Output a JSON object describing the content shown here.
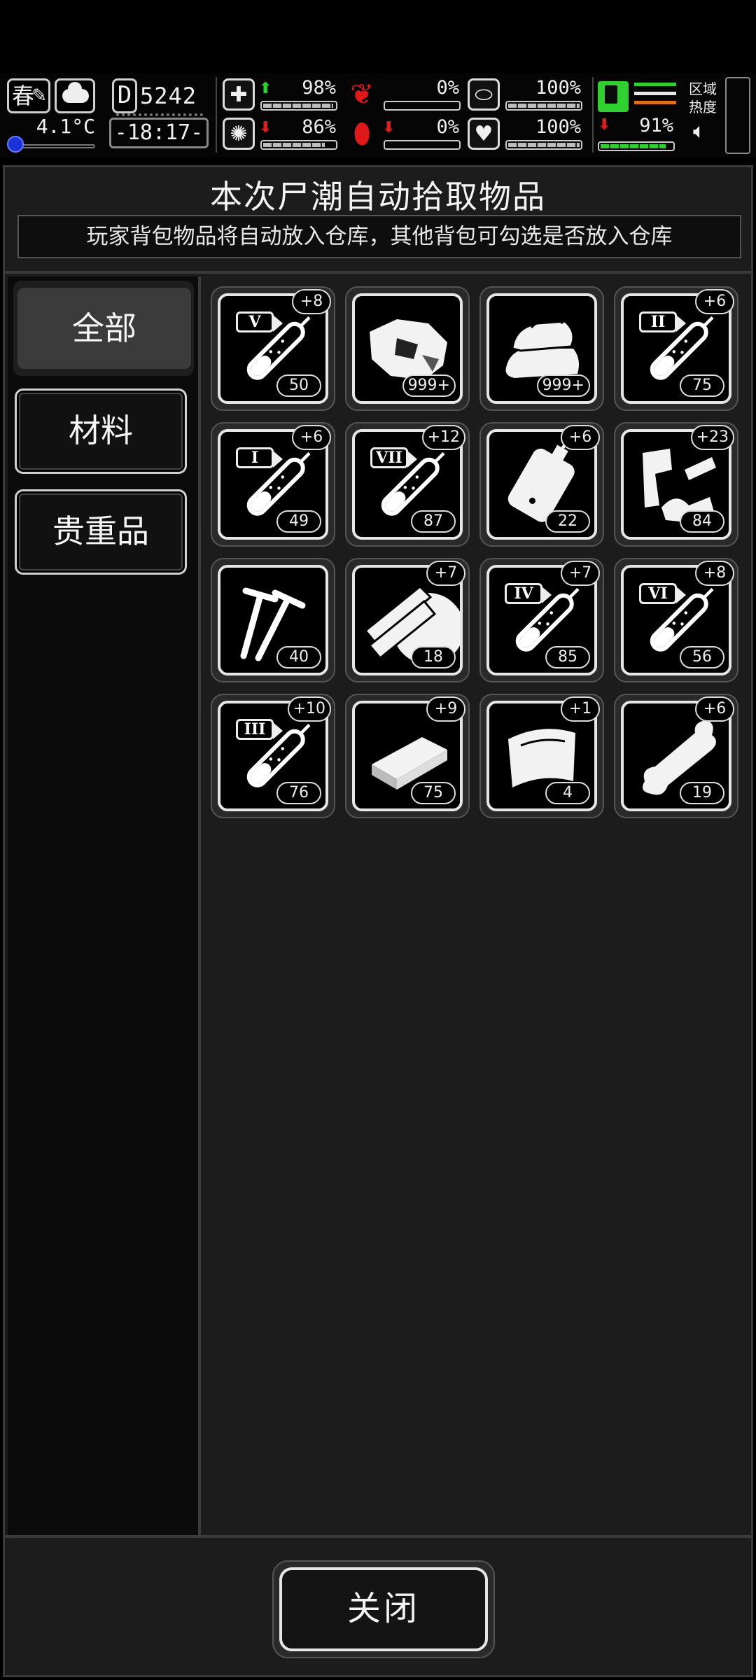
{
  "hud": {
    "season": "春",
    "temperature": "4.1°C",
    "day_label": "D",
    "day_number": "5242",
    "clock": "-18:17-",
    "stats": [
      {
        "icon": "medkit-icon",
        "glyph": "✚",
        "trend": "up",
        "value": "98%",
        "level": 0.98
      },
      {
        "icon": "stomach-icon",
        "glyph": "❦",
        "trend": "none",
        "value": "0%",
        "level": 0.0
      },
      {
        "icon": "pill-icon",
        "glyph": "⬭",
        "trend": "none",
        "value": "100%",
        "level": 1.0
      },
      {
        "icon": "brain-icon",
        "glyph": "✺",
        "trend": "down",
        "value": "86%",
        "level": 0.86
      },
      {
        "icon": "blood-drop-icon",
        "glyph": "⬮",
        "trend": "down",
        "value": "0%",
        "level": 0.0
      },
      {
        "icon": "heart-icon",
        "glyph": "♥",
        "trend": "none",
        "value": "100%",
        "level": 1.0
      }
    ],
    "stamina": {
      "trend": "down",
      "value": "91%",
      "level": 0.91
    },
    "zone_label_1": "区域",
    "zone_label_2": "热度",
    "colors": {
      "green": "#2fd02f",
      "red": "#e01818",
      "orange": "#e07018",
      "blue": "#1a32d8"
    }
  },
  "dialog": {
    "title": "本次尸潮自动拾取物品",
    "notice": "玩家背包物品将自动放入仓库，其他背包可勾选是否放入仓库",
    "tabs": [
      {
        "label": "全部",
        "active": true
      },
      {
        "label": "材料",
        "active": false
      },
      {
        "label": "贵重品",
        "active": false
      }
    ],
    "items": [
      {
        "icon": "syringe-icon",
        "roman": "V",
        "badge": "+8",
        "count": "50"
      },
      {
        "icon": "meat-chunk-icon",
        "roman": "",
        "badge": "",
        "count": "999+"
      },
      {
        "icon": "cloth-pile-icon",
        "roman": "",
        "badge": "",
        "count": "999+"
      },
      {
        "icon": "syringe-icon",
        "roman": "II",
        "badge": "+6",
        "count": "75"
      },
      {
        "icon": "syringe-icon",
        "roman": "I",
        "badge": "+6",
        "count": "49"
      },
      {
        "icon": "syringe-icon",
        "roman": "VII",
        "badge": "+12",
        "count": "87"
      },
      {
        "icon": "blood-bag-icon",
        "roman": "",
        "badge": "+6",
        "count": "22"
      },
      {
        "icon": "scrap-parts-icon",
        "roman": "",
        "badge": "+23",
        "count": "84"
      },
      {
        "icon": "nails-icon",
        "roman": "",
        "badge": "",
        "count": "40"
      },
      {
        "icon": "wood-planks-icon",
        "roman": "",
        "badge": "+7",
        "count": "18"
      },
      {
        "icon": "syringe-icon",
        "roman": "IV",
        "badge": "+7",
        "count": "85"
      },
      {
        "icon": "syringe-icon",
        "roman": "VI",
        "badge": "+8",
        "count": "56"
      },
      {
        "icon": "syringe-icon",
        "roman": "III",
        "badge": "+10",
        "count": "76"
      },
      {
        "icon": "metal-bar-icon",
        "roman": "",
        "badge": "+9",
        "count": "75"
      },
      {
        "icon": "bandage-icon",
        "roman": "",
        "badge": "+1",
        "count": "4"
      },
      {
        "icon": "bone-icon",
        "roman": "",
        "badge": "+6",
        "count": "19"
      }
    ],
    "close_label": "关闭"
  }
}
